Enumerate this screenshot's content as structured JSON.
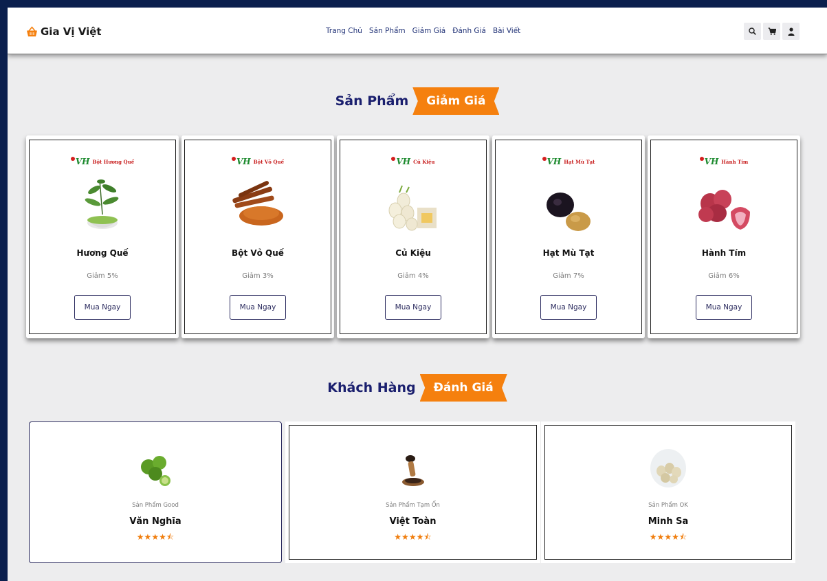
{
  "header": {
    "logo_text": "Gia Vị Việt",
    "nav": [
      "Trang Chủ",
      "Sản Phẩm",
      "Giảm Giá",
      "Đánh Giá",
      "Bài Viết"
    ],
    "icons": [
      "search-icon",
      "cart-icon",
      "user-icon"
    ]
  },
  "sections": {
    "products": {
      "title_a": "Sản Phẩm",
      "title_b": "Giảm Giá"
    },
    "reviews": {
      "title_a": "Khách Hàng",
      "title_b": "Đánh Giá"
    }
  },
  "brand_mark": "VH",
  "products": [
    {
      "brand_label": "Bột Hương Quế",
      "name": "Hương Quế",
      "discount": "Giảm 5%",
      "button": "Mua Ngay"
    },
    {
      "brand_label": "Bột Vỏ Quế",
      "name": "Bột Vỏ Quế",
      "discount": "Giảm 3%",
      "button": "Mua Ngay"
    },
    {
      "brand_label": "Củ Kiệu",
      "name": "Củ Kiệu",
      "discount": "Giảm 4%",
      "button": "Mua Ngay"
    },
    {
      "brand_label": "Hạt Mù Tạt",
      "name": "Hạt Mù Tạt",
      "discount": "Giảm 7%",
      "button": "Mua Ngay"
    },
    {
      "brand_label": "Hành Tím",
      "name": "Hành Tím",
      "discount": "Giảm 6%",
      "button": "Mua Ngay"
    }
  ],
  "reviews": [
    {
      "tag": "Sản Phẩm Good",
      "name": "Văn Nghĩa",
      "stars": "★★★★⯪",
      "rating": 4.5
    },
    {
      "tag": "Sản Phẩm Tạm Ổn",
      "name": "Việt Toàn",
      "stars": "★★★★⯪",
      "rating": 4.5
    },
    {
      "tag": "Sản Phẩm OK",
      "name": "Minh Sa",
      "stars": "★★★★⯪",
      "rating": 4.5
    }
  ],
  "colors": {
    "accent": "#f5800e",
    "navy": "#1a1f6e",
    "frame": "#0b1f4d"
  }
}
